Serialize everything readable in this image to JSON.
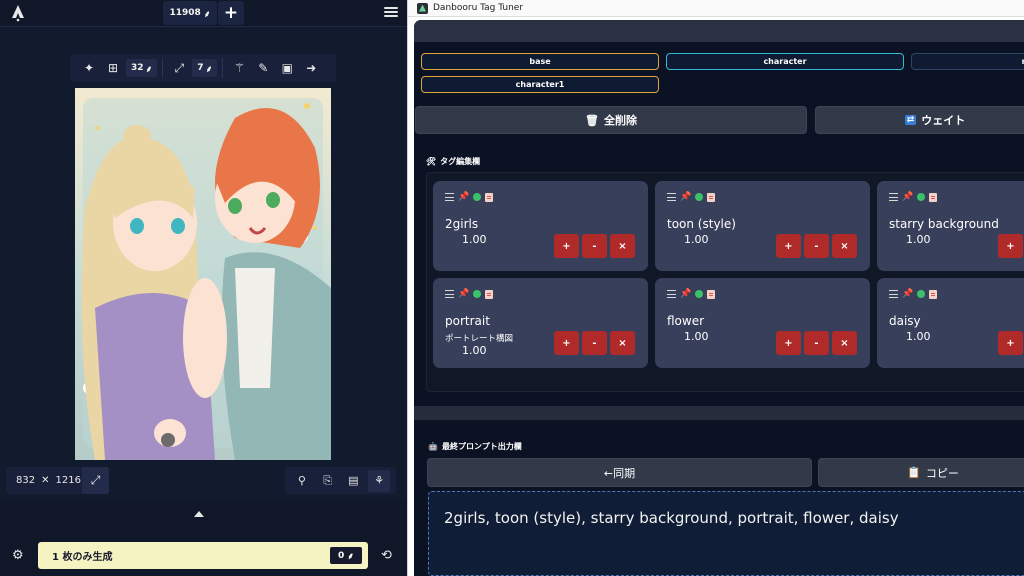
{
  "left": {
    "anlas_balance": "11908",
    "toolbar": {
      "samples_count": "32",
      "steps_count": "7"
    },
    "dims": {
      "width": "832",
      "times": "✕",
      "height": "1216"
    },
    "generate": {
      "label": "1 枚のみ生成",
      "cost": "0"
    }
  },
  "right": {
    "window_title": "Danbooru Tag Tuner",
    "tabs": [
      {
        "label": "base",
        "color": "#e2a33a"
      },
      {
        "label": "character",
        "color": "#31b8d4"
      },
      {
        "label": "neg",
        "color": "#2f4466"
      },
      {
        "label": "character1",
        "color": "#e2a33a"
      }
    ],
    "actions": {
      "clear_all": "全削除",
      "weight": "ウェイト"
    },
    "tag_section_label": "タグ編集欄",
    "tags": [
      {
        "name": "2girls",
        "sub": "",
        "weight": "1.00"
      },
      {
        "name": "toon (style)",
        "sub": "",
        "weight": "1.00"
      },
      {
        "name": "starry background",
        "sub": "",
        "weight": "1.00"
      },
      {
        "name": "portrait",
        "sub": "ポートレート構図",
        "weight": "1.00"
      },
      {
        "name": "flower",
        "sub": "",
        "weight": "1.00"
      },
      {
        "name": "daisy",
        "sub": "",
        "weight": "1.00"
      }
    ],
    "card_buttons": {
      "plus": "+",
      "minus": "-",
      "remove": "×"
    },
    "output_section_label": "最終プロンプト出力欄",
    "sync_label": "←同期",
    "copy_label": "コピー",
    "final_prompt": "2girls, toon (style), starry background, portrait, flower, daisy"
  },
  "colors": {
    "accent_yellow": "#f5f3c1",
    "danger_red": "#b12a2a",
    "card_bg": "#383f5a"
  }
}
